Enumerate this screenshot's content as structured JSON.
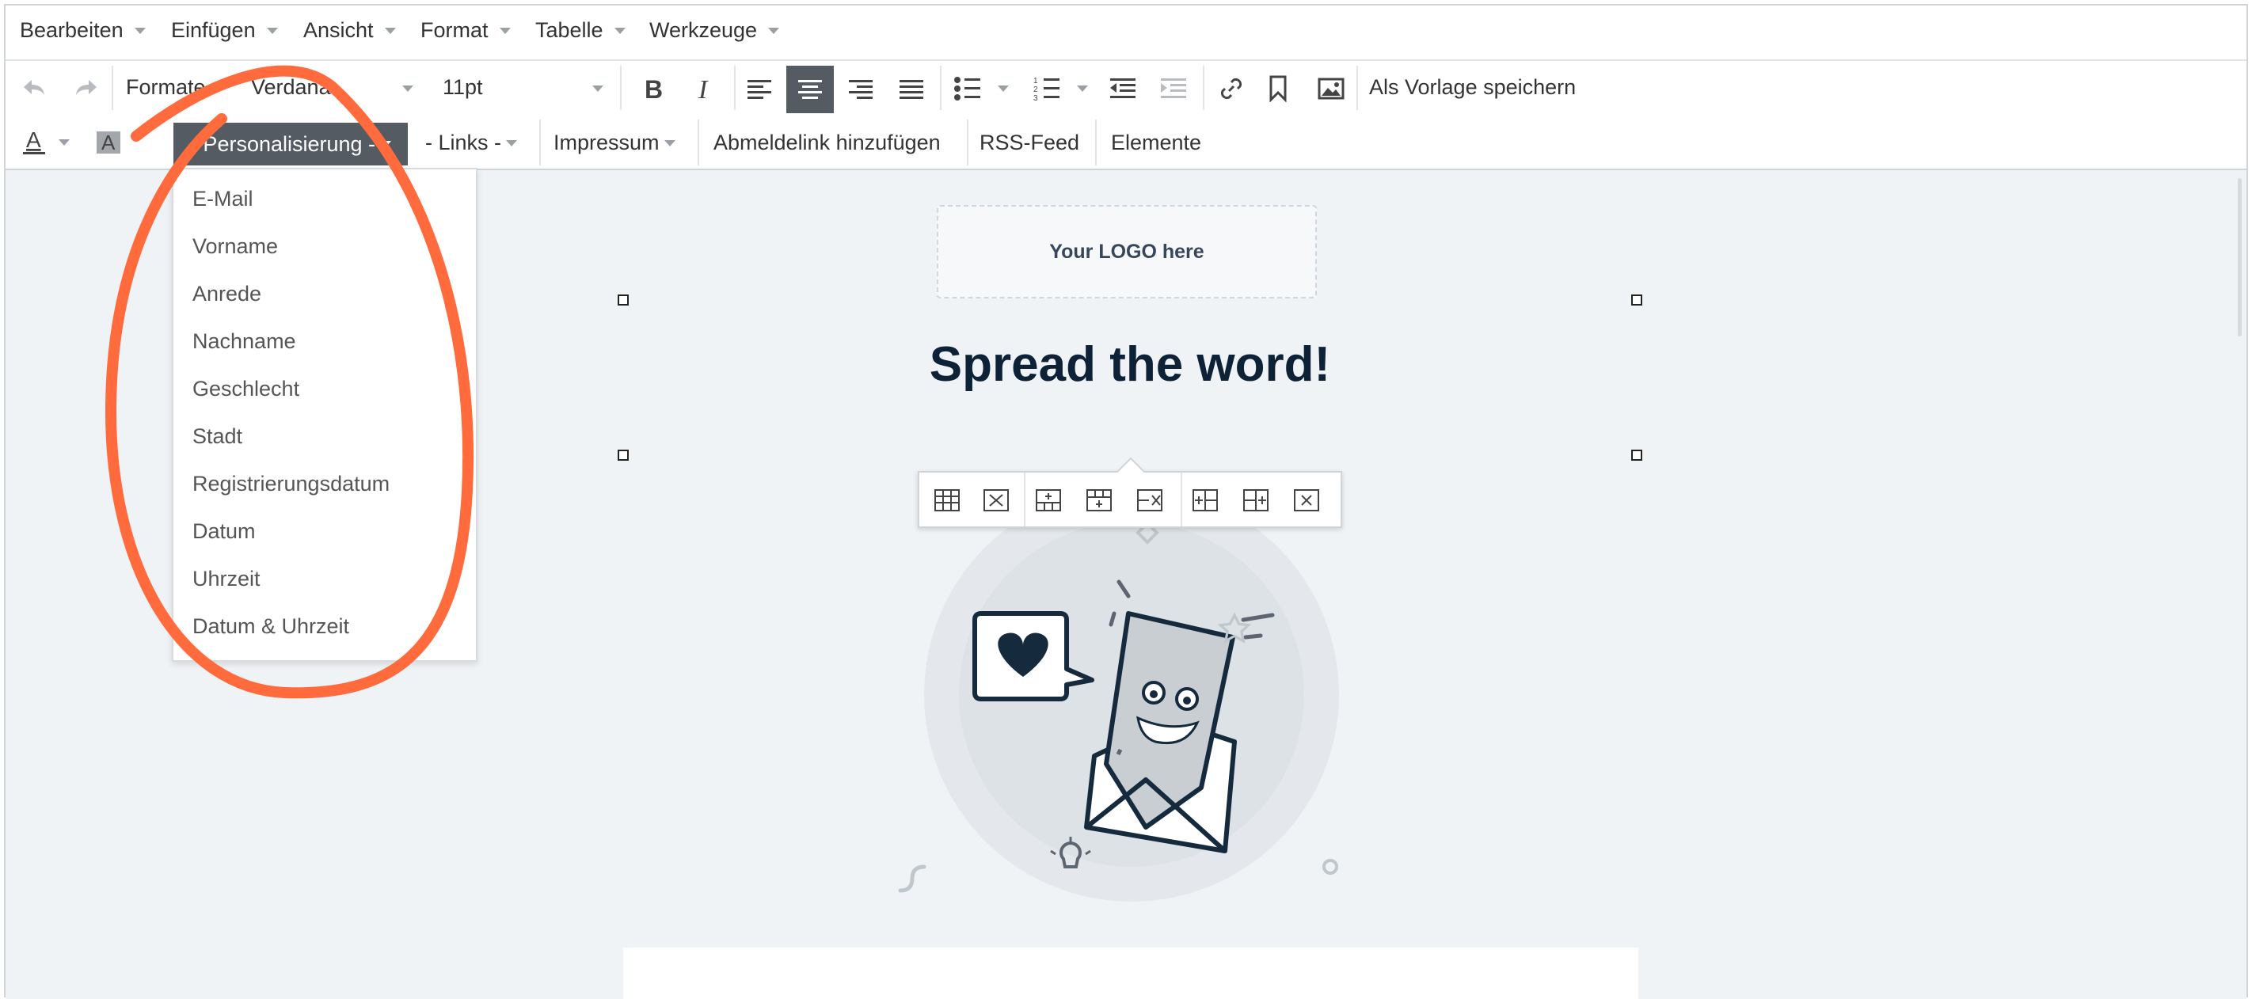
{
  "menubar": {
    "items": [
      "Bearbeiten",
      "Einfügen",
      "Ansicht",
      "Format",
      "Tabelle",
      "Werkzeuge"
    ]
  },
  "toolbar1": {
    "formats_label": "Formate",
    "font_family": "Verdana",
    "font_size": "11pt",
    "save_template_label": "Als Vorlage speichern"
  },
  "toolbar2": {
    "personalisierung_label": "- Personalisierung -",
    "links_label": "- Links -",
    "impressum_label": "Impressum",
    "abmeldelink_label": "Abmeldelink hinzufügen",
    "rss_label": "RSS-Feed",
    "elemente_label": "Elemente"
  },
  "dropdown": {
    "items": [
      "E-Mail",
      "Vorname",
      "Anrede",
      "Nachname",
      "Geschlecht",
      "Stadt",
      "Registrierungsdatum",
      "Datum",
      "Uhrzeit",
      "Datum & Uhrzeit"
    ]
  },
  "content": {
    "logo_placeholder": "Your LOGO here",
    "headline": "Spread the word!"
  },
  "colors": {
    "annotation": "#ff6b3d",
    "active_button": "#555b62",
    "canvas_bg": "#f0f3f6",
    "headline": "#0d2137"
  },
  "icons": [
    "undo-icon",
    "redo-icon",
    "bold-icon",
    "italic-icon",
    "align-left-icon",
    "align-center-icon",
    "align-right-icon",
    "align-justify-icon",
    "bullet-list-icon",
    "numbered-list-icon",
    "outdent-icon",
    "indent-icon",
    "link-icon",
    "bookmark-icon",
    "image-icon",
    "text-color-icon",
    "background-color-icon"
  ]
}
